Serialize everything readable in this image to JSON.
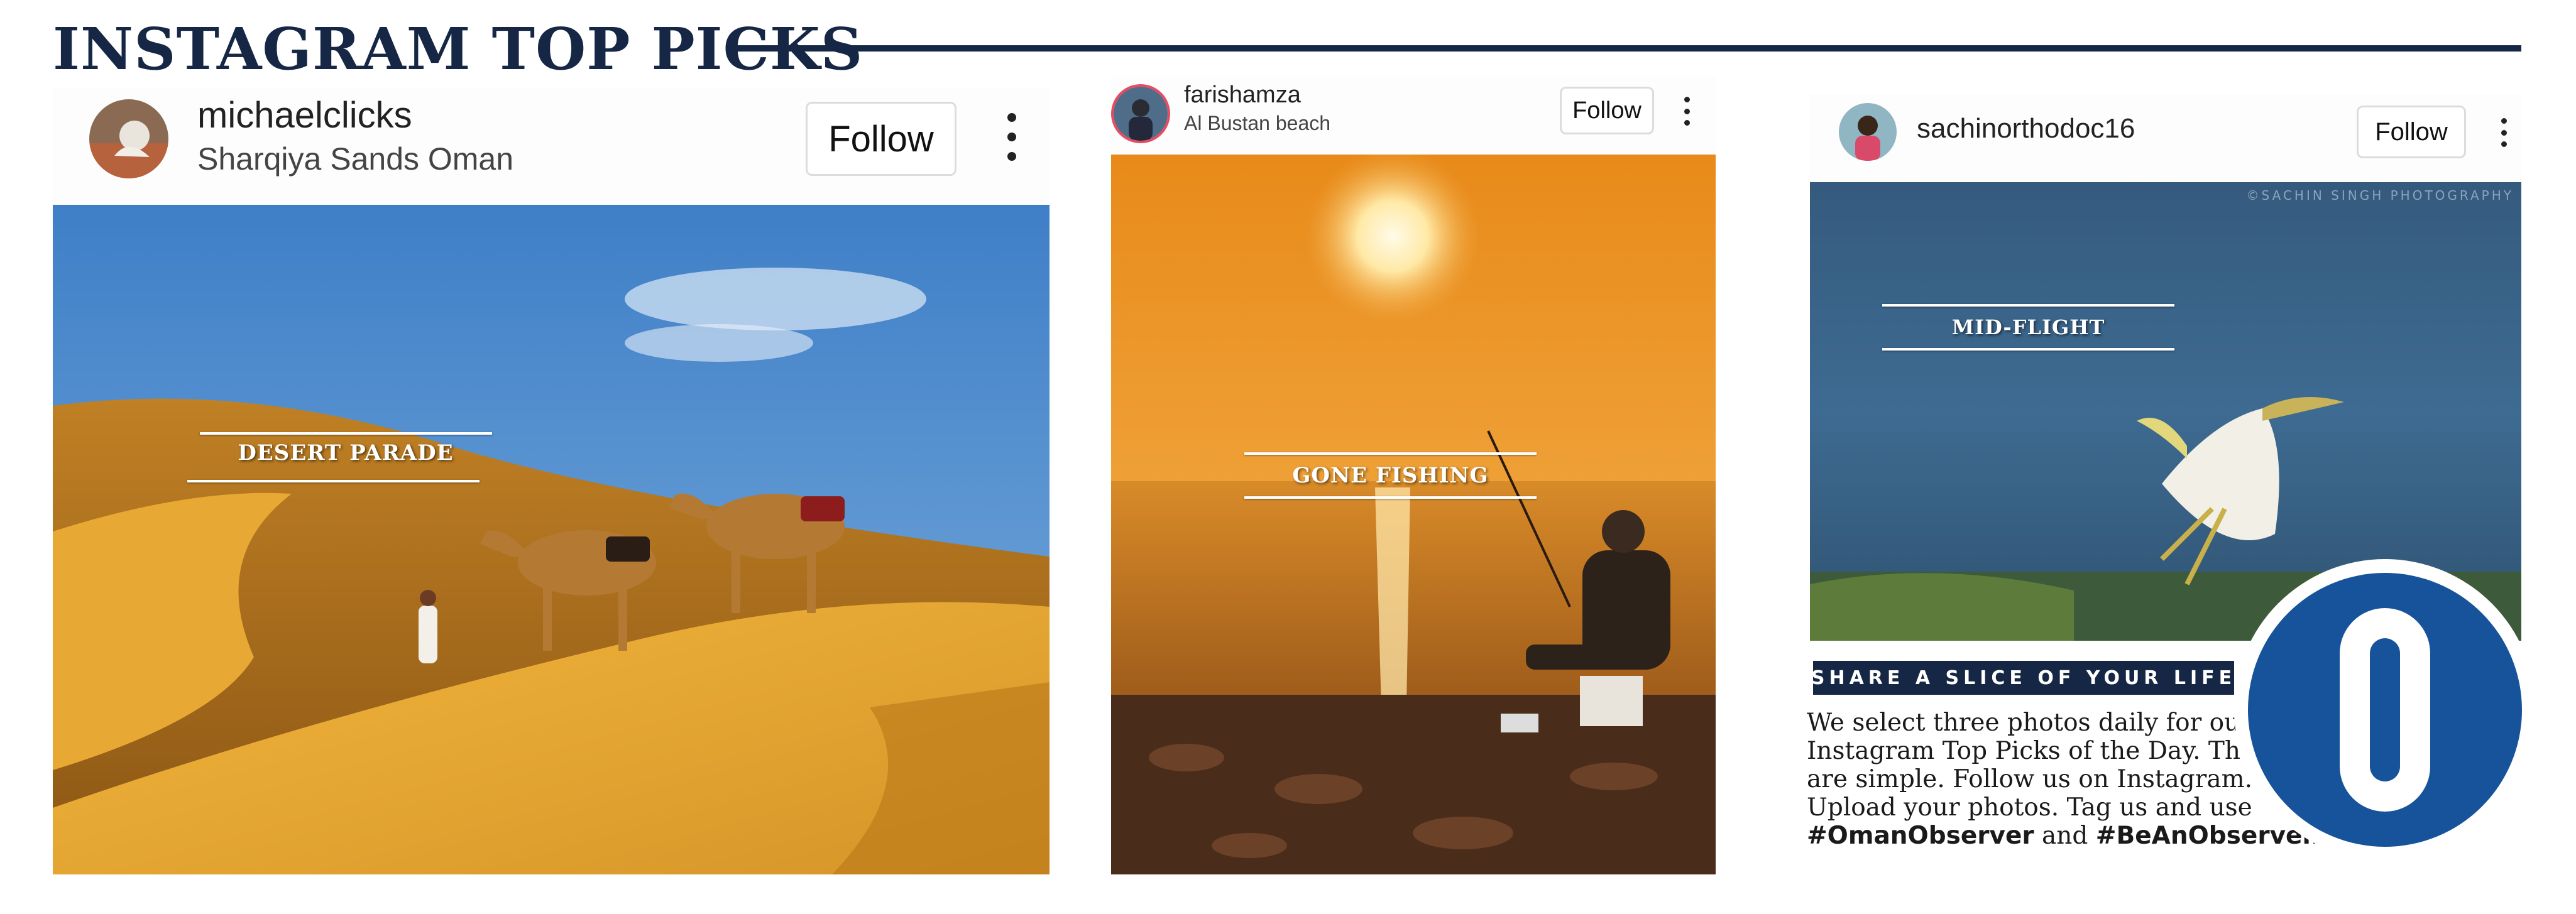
{
  "section": {
    "title": "INSTAGRAM TOP PICKS"
  },
  "posts": [
    {
      "username": "michaelclicks",
      "location": "Sharqiya Sands Oman",
      "follow_label": "Follow",
      "caption": "DESERT PARADE"
    },
    {
      "username": "farishamza",
      "location": "Al Bustan beach",
      "follow_label": "Follow",
      "caption": "GONE FISHING"
    },
    {
      "username": "sachinorthodoc16",
      "follow_label": "Follow",
      "caption": "MID-FLIGHT",
      "watermark": "©SACHIN SINGH PHOTOGRAPHY"
    }
  ],
  "share": {
    "banner": "SHARE A SLICE OF YOUR LIFE",
    "text": "We select three photos daily for our Instagram Top Picks of the Day. The rules are simple. Follow us on Instagram. Upload your photos. Tag us and use",
    "hashtag1": "#OmanObserver",
    "connector": "and",
    "hashtag2": "#BeAnObserver."
  },
  "logo": {
    "letter": "O"
  },
  "colors": {
    "navy": "#152744",
    "logo_blue": "#16539a",
    "desert_sand": "#d49a2c",
    "sunset_orange": "#e49524"
  }
}
